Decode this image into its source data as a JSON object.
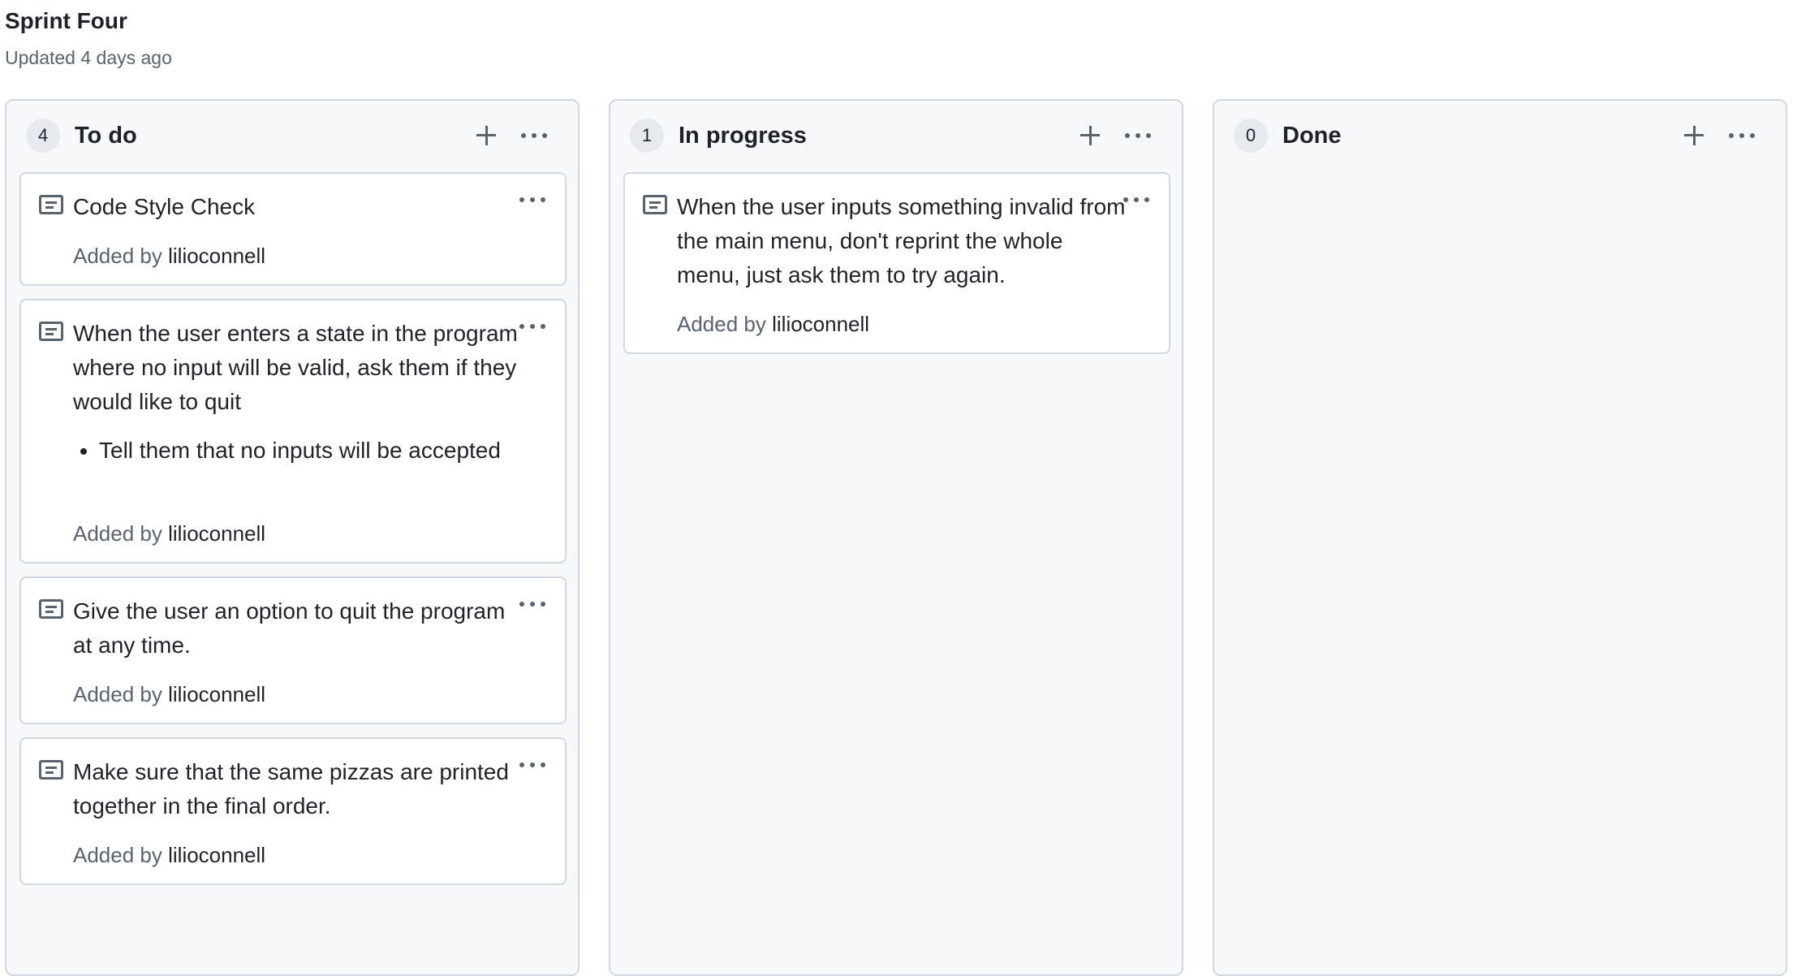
{
  "view": {
    "title": "Sprint Four",
    "updated": "Updated 4 days ago"
  },
  "columns": [
    {
      "count": "4",
      "title": "To do",
      "cards": [
        {
          "title": "Code Style Check",
          "bullets": [],
          "added_prefix": "Added by",
          "user": "lilioconnell"
        },
        {
          "title": "When the user enters a state in the program where no input will be valid, ask them if they would like to quit",
          "bullets": [
            "Tell them that no inputs will be accepted"
          ],
          "added_prefix": "Added by",
          "user": "lilioconnell"
        },
        {
          "title": "Give the user an option to quit the program at any time.",
          "bullets": [],
          "added_prefix": "Added by",
          "user": "lilioconnell"
        },
        {
          "title": "Make sure that the same pizzas are printed together in the final order.",
          "bullets": [],
          "added_prefix": "Added by",
          "user": "lilioconnell"
        }
      ]
    },
    {
      "count": "1",
      "title": "In progress",
      "cards": [
        {
          "title": "When the user inputs something invalid from the main menu, don't reprint the whole menu, just ask them to try again.",
          "bullets": [],
          "added_prefix": "Added by",
          "user": "lilioconnell"
        }
      ]
    },
    {
      "count": "0",
      "title": "Done",
      "cards": []
    }
  ],
  "icons": {
    "add": "plus-icon",
    "more": "kebab-horizontal-icon",
    "card": "note-icon"
  },
  "colors": {
    "column_bg": "#f6f8fa",
    "border": "#d1d9e0",
    "muted_text": "#59636e",
    "text": "#1f2328"
  }
}
